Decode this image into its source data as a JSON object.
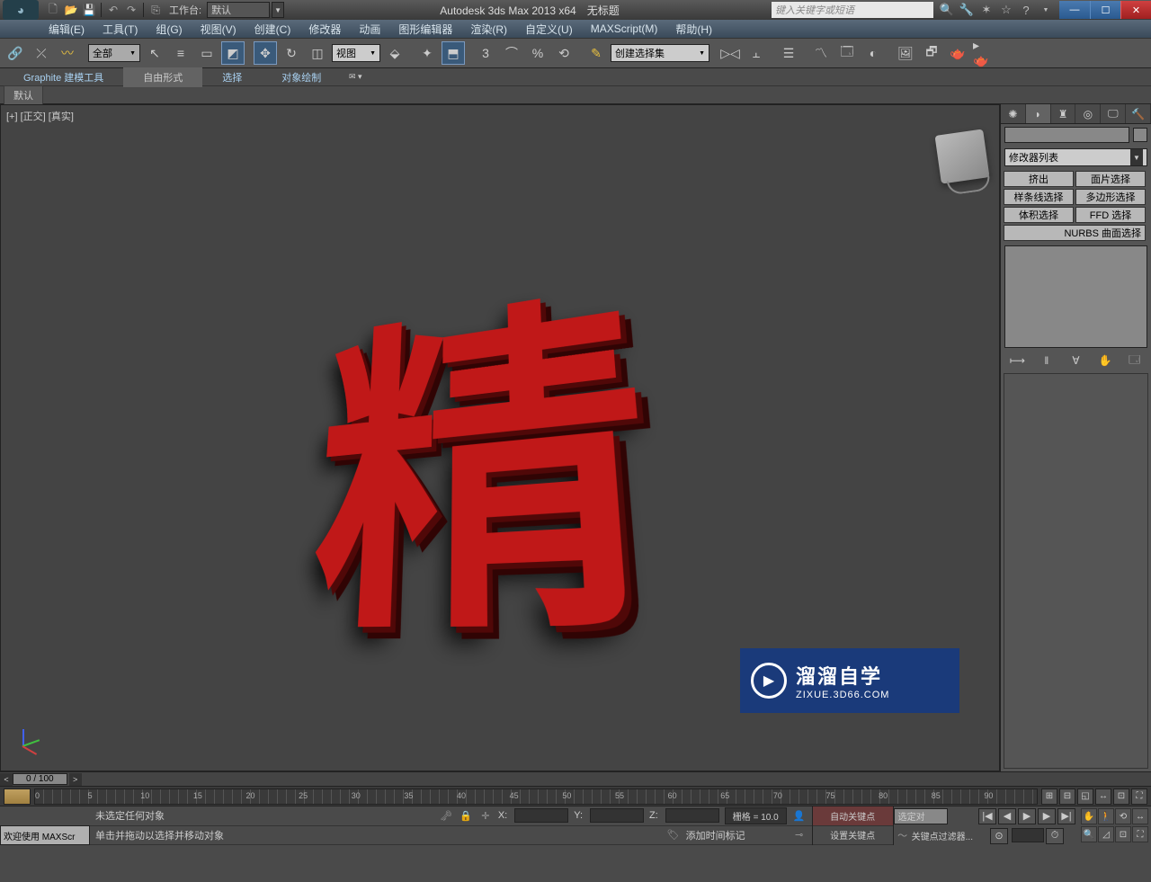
{
  "title": {
    "app": "Autodesk 3ds Max  2013 x64",
    "doc": "无标题"
  },
  "workspace": {
    "label": "工作台:",
    "value": "默认"
  },
  "search": {
    "placeholder": "键入关键字或短语"
  },
  "menu": [
    "编辑(E)",
    "工具(T)",
    "组(G)",
    "视图(V)",
    "创建(C)",
    "修改器",
    "动画",
    "图形编辑器",
    "渲染(R)",
    "自定义(U)",
    "MAXScript(M)",
    "帮助(H)"
  ],
  "toolbar": {
    "filter": "全部",
    "viewmode": "视图",
    "selectset": "创建选择集"
  },
  "ribbon": {
    "tabs": [
      "Graphite 建模工具",
      "自由形式",
      "选择",
      "对象绘制"
    ],
    "active": 1,
    "subtab": "默认"
  },
  "viewport": {
    "label": "[+] [正交] [真实]",
    "char": "精"
  },
  "command_panel": {
    "modifier_list": "修改器列表",
    "mod_buttons": [
      "挤出",
      "面片选择",
      "样条线选择",
      "多边形选择",
      "体积选择",
      "FFD 选择",
      "NURBS 曲面选择"
    ]
  },
  "timebar": {
    "frames": "0 / 100"
  },
  "timeline": {
    "ticks": [
      0,
      5,
      10,
      15,
      20,
      25,
      30,
      35,
      40,
      45,
      50,
      55,
      60,
      65,
      70,
      75,
      80,
      85,
      90
    ]
  },
  "status": {
    "welcome": "欢迎使用  MAXScr",
    "prompt1": "未选定任何对象",
    "prompt2": "单击并拖动以选择并移动对象",
    "grid": "栅格 = 10.0",
    "addtime": "添加时间标记",
    "autokey": "自动关键点",
    "setkey": "设置关键点",
    "selset": "选定对",
    "keyfilter": "关键点过滤器..."
  },
  "watermark": {
    "big": "溜溜自学",
    "small": "ZIXUE.3D66.COM"
  }
}
